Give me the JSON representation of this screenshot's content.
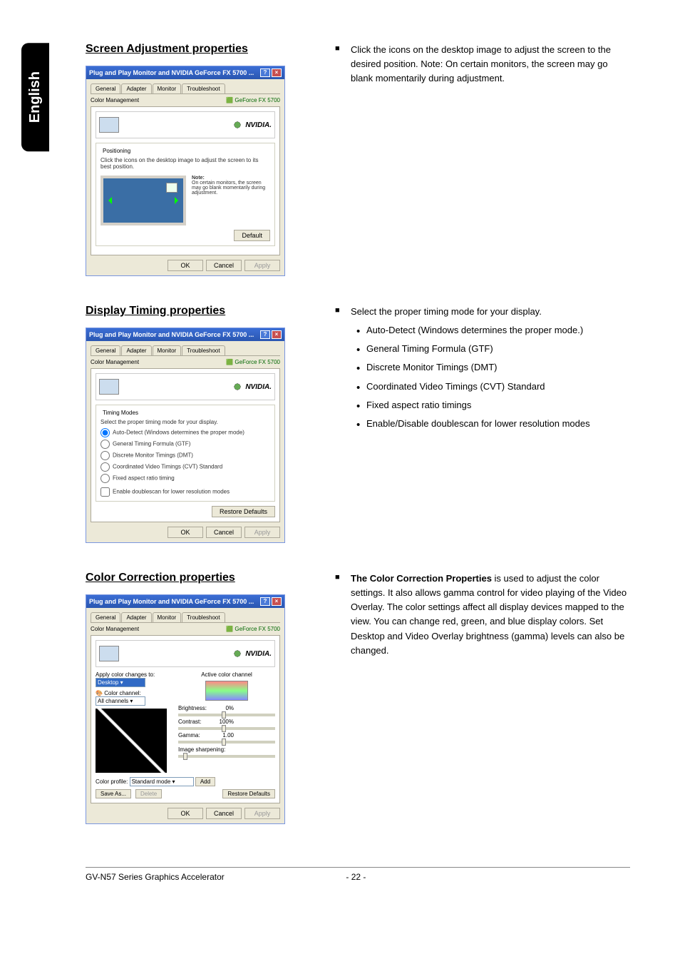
{
  "tab_label": "English",
  "sections": {
    "screen": {
      "title": "Screen Adjustment properties",
      "bullets": [
        "Click the icons on the desktop image to adjust the screen to the desired position. Note: On certain monitors, the screen may go blank momentarily during adjustment."
      ]
    },
    "timing": {
      "title": "Display Timing properties",
      "bullets": [
        "Select the proper timing mode for your display."
      ],
      "sub": [
        "Auto-Detect (Windows determines the proper mode.)",
        "General Timing Formula (GTF)",
        "Discrete Monitor Timings (DMT)",
        "Coordinated Video Timings (CVT) Standard",
        "Fixed aspect ratio timings",
        "Enable/Disable doublescan for lower resolution modes"
      ]
    },
    "color": {
      "title": "Color Correction properties",
      "bullets": [
        "<b>The Color Correction Properties</b> is used to adjust the color settings. It also allows gamma control for video playing of the Video Overlay. The color settings affect all display devices mapped to the view. You can change red, green, and blue display colors. Set Desktop and Video Overlay brightness (gamma) levels can also be changed."
      ]
    }
  },
  "dialog": {
    "title": "Plug and Play Monitor and NVIDIA GeForce FX 5700 ...",
    "tabs": {
      "general": "General",
      "adapter": "Adapter",
      "monitor": "Monitor",
      "troubleshoot": "Troubleshoot"
    },
    "troubleshoot_line": "Color Management",
    "gf_line": "GeForce FX 5700",
    "brand": "NVIDIA.",
    "buttons": {
      "ok": "OK",
      "cancel": "Cancel",
      "apply": "Apply"
    },
    "screen": {
      "group": "Positioning",
      "desc": "Click the icons on the desktop image to adjust the screen to its best position.",
      "note_title": "Note:",
      "note_body": "On certain monitors, the screen may go blank momentarily during adjustment.",
      "default": "Default"
    },
    "timing": {
      "group": "Timing Modes",
      "group_desc": "Select the proper timing mode for your display.",
      "opts": [
        "Auto-Detect (Windows determines the proper mode)",
        "General Timing Formula (GTF)",
        "Discrete Monitor Timings (DMT)",
        "Coordinated Video Timings (CVT) Standard",
        "Fixed aspect ratio timing"
      ],
      "chk": "Enable doublescan for lower resolution modes",
      "restore": "Restore Defaults"
    },
    "color": {
      "apply_label": "Apply color changes to:",
      "apply_val": "Desktop",
      "channel_label": "Color channel:",
      "channel_val": "All channels",
      "active": "Active color channel",
      "brightness": "Brightness:",
      "contrast": "Contrast:",
      "gamma": "Gamma:",
      "brightness_val": "0%",
      "contrast_val": "100%",
      "gamma_val": "1.00",
      "image_sharp": "Image sharpening:",
      "profile": "Color profile:",
      "profile_val": "Standard mode",
      "add": "Add",
      "saveas": "Save As...",
      "delete": "Delete",
      "restore": "Restore Defaults"
    }
  },
  "footer": {
    "left": "GV-N57 Series Graphics Accelerator",
    "right": "- 22 -"
  }
}
